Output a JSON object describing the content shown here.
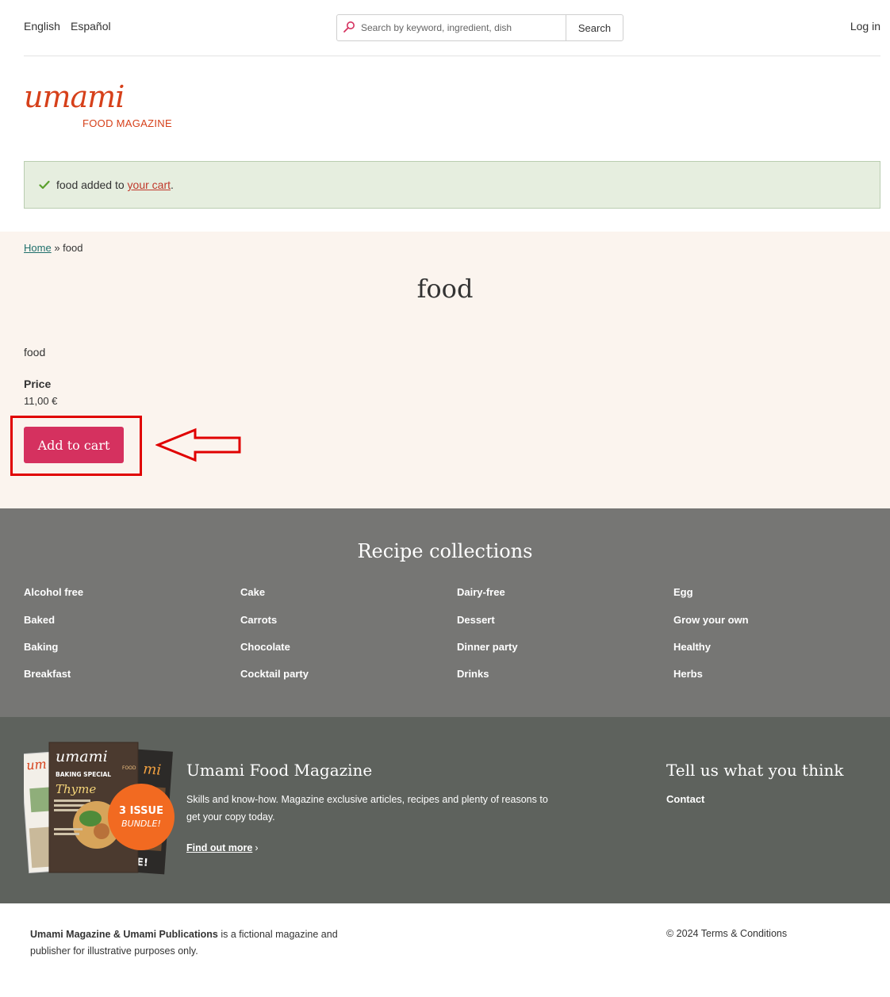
{
  "header": {
    "languages": [
      "English",
      "Español"
    ],
    "search": {
      "placeholder": "Search by keyword, ingredient, dish",
      "button": "Search"
    },
    "login": "Log in"
  },
  "logo": {
    "wordmark": "umami",
    "subtitle": "FOOD MAGAZINE"
  },
  "notice": {
    "text_before": "food added to ",
    "link": "your cart",
    "text_after": "."
  },
  "breadcrumb": {
    "home": "Home",
    "separator": "»",
    "current": "food"
  },
  "product": {
    "title": "food",
    "description": "food",
    "price_label": "Price",
    "price": "11,00 €",
    "add_to_cart": "Add to cart"
  },
  "collections": {
    "title": "Recipe collections",
    "columns": [
      [
        "Alcohol free",
        "Baked",
        "Baking",
        "Breakfast"
      ],
      [
        "Cake",
        "Carrots",
        "Chocolate",
        "Cocktail party"
      ],
      [
        "Dairy-free",
        "Dessert",
        "Dinner party",
        "Drinks"
      ],
      [
        "Egg",
        "Grow your own",
        "Healthy",
        "Herbs"
      ]
    ]
  },
  "magazine": {
    "title": "Umami Food Magazine",
    "description": "Skills and know-how. Magazine exclusive articles, recipes and plenty of reasons to get your copy today.",
    "link": "Find out more",
    "badge_line1": "3 ISSUE",
    "badge_line2": "BUNDLE!",
    "cover_title": "umami",
    "cover_tag": "FOOD",
    "cover_special": "BAKING SPECIAL",
    "cover_feature": "Thyme"
  },
  "feedback": {
    "title": "Tell us what you think",
    "contact": "Contact"
  },
  "footer": {
    "brand": "Umami Magazine & Umami Publications",
    "text": " is a fictional magazine and publisher for illustrative purposes only.",
    "copyright": "© 2024 Terms & Conditions"
  },
  "colors": {
    "brand": "#d6401a",
    "button": "#d5315f",
    "highlight": "#e00000",
    "collections_bg": "#767674",
    "magazine_bg": "#5e625d",
    "product_bg": "#fbf4ee",
    "notice_bg": "#e6eedf"
  },
  "icons": {
    "search": "search-icon",
    "check": "check-icon",
    "arrow": "left-arrow-annotation",
    "chevron": "chevron-right-icon"
  }
}
